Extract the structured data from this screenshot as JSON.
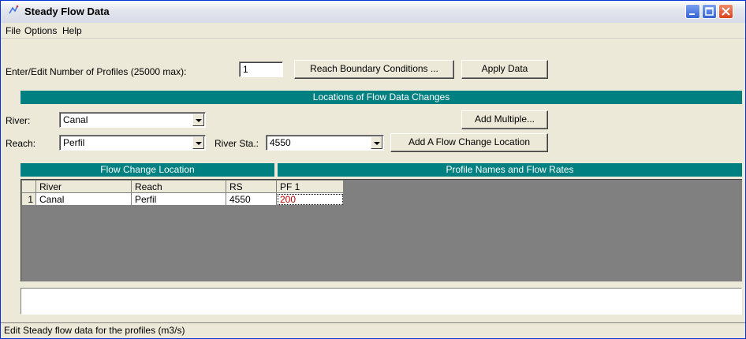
{
  "window": {
    "title": "Steady Flow Data",
    "icon": "hec-ras-app-icon"
  },
  "menu": [
    "File",
    "Options",
    "Help"
  ],
  "profiles": {
    "label": "Enter/Edit Number of Profiles (25000 max):",
    "value": "1"
  },
  "buttons": {
    "reach_boundary": "Reach Boundary Conditions ...",
    "apply_data": "Apply Data",
    "add_multiple": "Add Multiple...",
    "add_flow_change": "Add A Flow Change Location"
  },
  "locations_header": "Locations of Flow Data Changes",
  "river": {
    "label": "River:",
    "value": "Canal"
  },
  "reach": {
    "label": "Reach:",
    "value": "Perfil"
  },
  "river_sta": {
    "label": "River Sta.:",
    "value": "4550"
  },
  "grid_headers": {
    "flow_change_location": "Flow Change Location",
    "profile_names": "Profile Names and Flow Rates"
  },
  "table": {
    "columns": [
      "River",
      "Reach",
      "RS",
      "PF 1"
    ],
    "rows": [
      {
        "num": "1",
        "river": "Canal",
        "reach": "Perfil",
        "rs": "4550",
        "pf1": "200"
      }
    ]
  },
  "status": "Edit Steady flow data for the profiles (m3/s)",
  "colors": {
    "header_bar": "#008080",
    "grid_background": "#808080",
    "selected_value": "#c00000"
  }
}
